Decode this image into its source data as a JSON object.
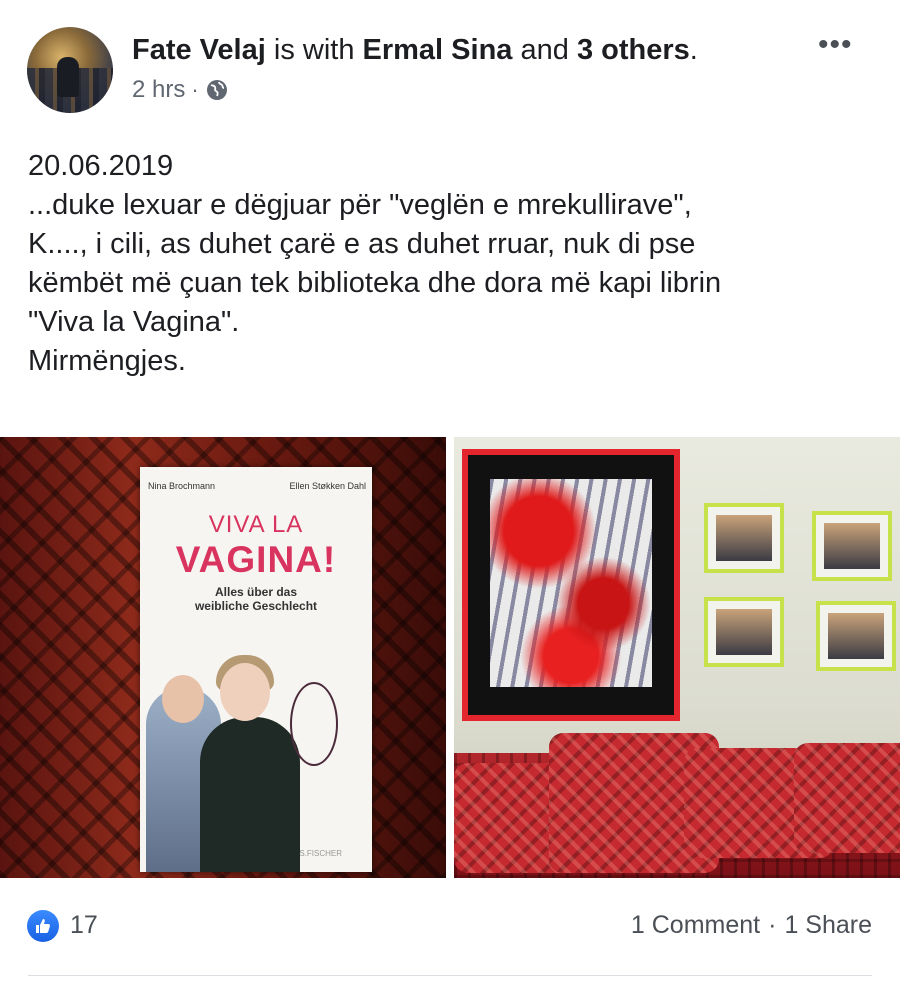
{
  "post": {
    "author": "Fate Velaj",
    "with_text": "is with",
    "tagged_person": "Ermal Sina",
    "and_text": "and",
    "others": "3 others",
    "period": ".",
    "time": "2 hrs",
    "separator": "·",
    "privacy_icon": "globe-icon",
    "more_icon": "more-options-icon",
    "more_glyph": "•••",
    "text": "20.06.2019\n...duke lexuar e dëgjuar për \"veglën e mrekullirave\",\nK...., i cili, as duhet çarë e as duhet rruar, nuk di pse\nkëmbët më çuan tek biblioteka dhe dora më kapi librin\n\"Viva la Vagina\".\nMirmëngjes."
  },
  "photos": {
    "left": {
      "book_author_1": "Nina Brochmann",
      "book_author_2": "Ellen Støkken Dahl",
      "book_title_1": "VIVA LA",
      "book_title_2": "VAGINA!",
      "book_subtitle": "Alles über das\nweibliche Geschlecht",
      "publisher": "S.FISCHER"
    }
  },
  "footer": {
    "like_icon": "like-thumb-icon",
    "like_color": "#1861e4",
    "like_count": "17",
    "comments": "1 Comment",
    "separator": "·",
    "shares": "1 Share"
  }
}
